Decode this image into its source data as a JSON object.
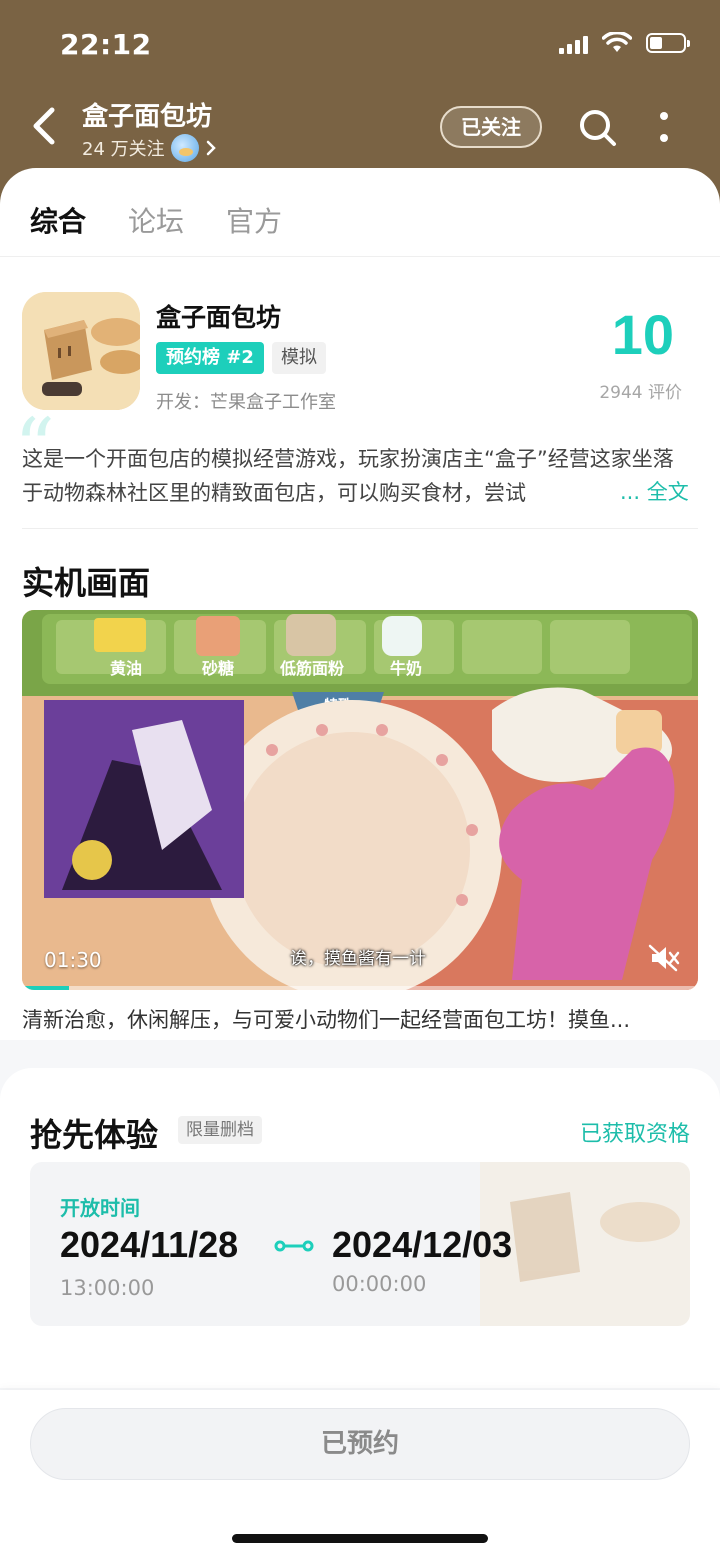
{
  "status_bar": {
    "time": "22:12"
  },
  "header": {
    "title": "盒子面包坊",
    "followers": "24 万关注",
    "follow_button": "已关注"
  },
  "tabs": [
    {
      "label": "综合",
      "active": true
    },
    {
      "label": "论坛",
      "active": false
    },
    {
      "label": "官方",
      "active": false
    }
  ],
  "app": {
    "name": "盒子面包坊",
    "rank_badge": "预约榜 #2",
    "genre_tag": "模拟",
    "developer": "开发：芒果盒子工作室",
    "score": "10",
    "rating_count": "2944 评价",
    "description": "这是一个开面包店的模拟经营游戏，玩家扮演店主“盒子”经营这家坐落于动物森林社区里的精致面包店，可以购买食材，尝试",
    "more_label": "... 全文"
  },
  "screenshots_section": {
    "title": "实机画面",
    "video_duration": "01:30",
    "subtitle_text": "诶，摸鱼酱有一计",
    "caption": "清新治愈，休闲解压，与可爱小动物们一起经营面包工坊！摸鱼...",
    "progress_fraction": 0.07,
    "game_labels": [
      "黄油",
      "砂糖",
      "低筋面粉",
      "牛奶",
      "特殊"
    ]
  },
  "early_access": {
    "title": "抢先体验",
    "tag": "限量删档",
    "status": "已获取资格",
    "open_time_label": "开放时间",
    "start_date": "2024/11/28",
    "start_time": "13:00:00",
    "end_date": "2024/12/03",
    "end_time": "00:00:00"
  },
  "bottom": {
    "reserve_button": "已预约"
  },
  "colors": {
    "accent": "#1dcfbb",
    "header_bg": "#7a6344"
  },
  "icons": [
    "back-arrow-icon",
    "search-icon",
    "more-vertical-icon",
    "globe-icon",
    "chevron-right-icon",
    "mute-icon",
    "link-arrow-icon",
    "signal-icon",
    "wifi-icon",
    "battery-icon"
  ]
}
